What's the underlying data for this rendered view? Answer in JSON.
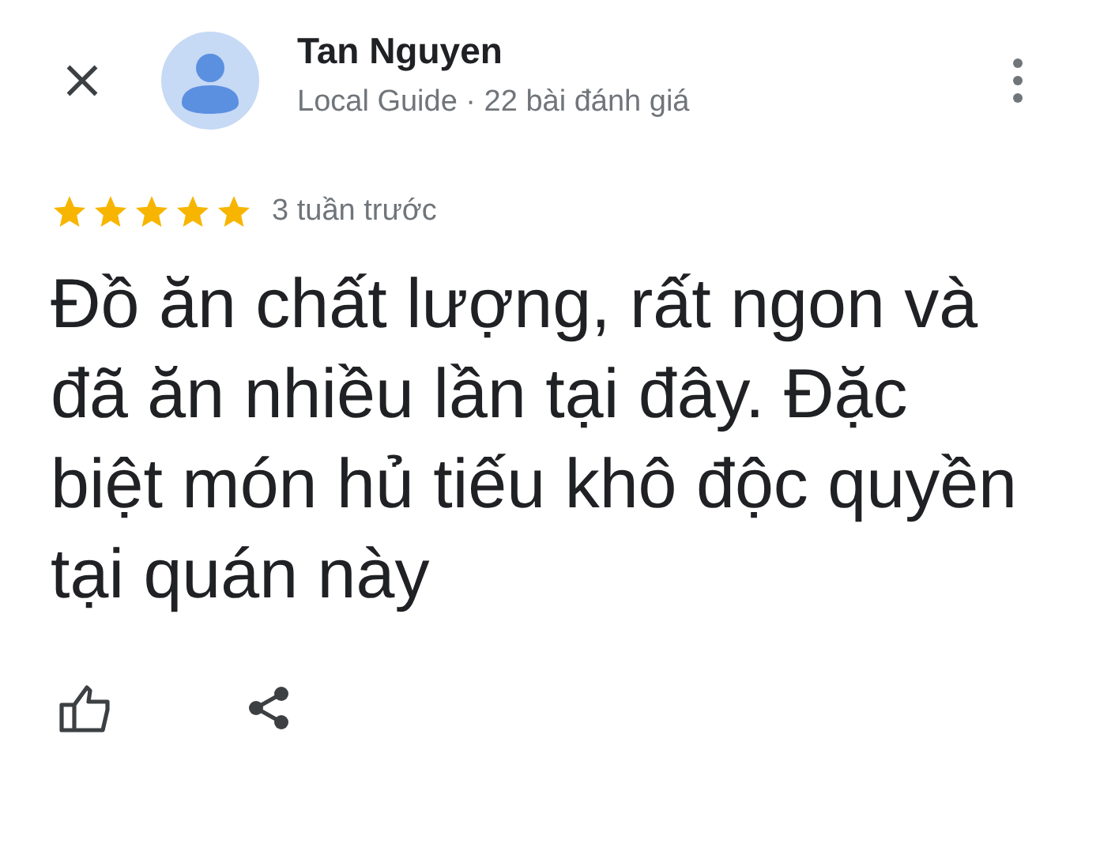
{
  "reviewer": {
    "name": "Tan Nguyen",
    "subtitle": "Local Guide · 22 bài đánh giá"
  },
  "rating": {
    "stars": 5,
    "time": "3 tuần trước"
  },
  "review_text": "Đồ ăn chất lượng, rất ngon và đã ăn nhiều lần tại đây. Đặc biệt món hủ tiếu khô độc quyền tại quán này"
}
